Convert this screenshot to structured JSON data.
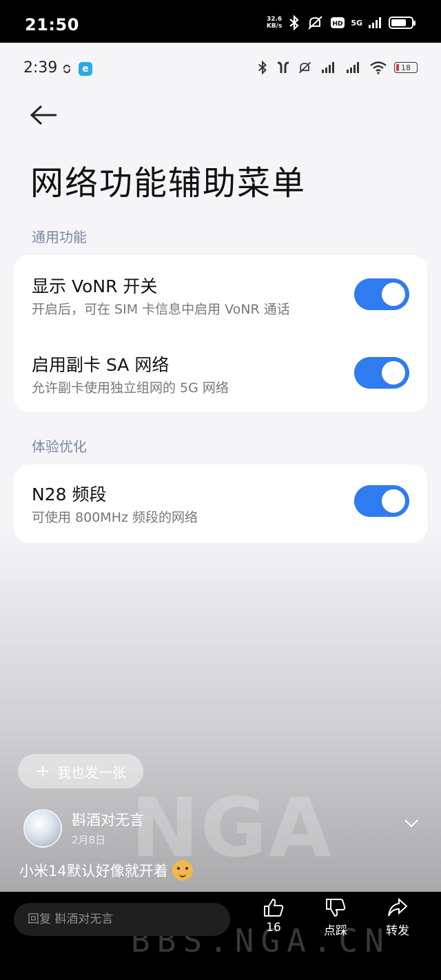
{
  "outer_status": {
    "time": "21:50",
    "speed_value": "32.6",
    "speed_unit": "KB/s",
    "network": "5G"
  },
  "inner_status": {
    "time": "2:39",
    "battery": "18"
  },
  "page": {
    "title": "网络功能辅助菜单"
  },
  "sections": [
    {
      "label": "通用功能",
      "items": [
        {
          "title": "显示 VoNR 开关",
          "subtitle": "开启后，可在 SIM 卡信息中启用 VoNR 通话",
          "enabled": true
        },
        {
          "title": "启用副卡 SA 网络",
          "subtitle": "允许副卡使用独立组网的 5G 网络",
          "enabled": true
        }
      ]
    },
    {
      "label": "体验优化",
      "items": [
        {
          "title": "N28 频段",
          "subtitle": "可使用 800MHz 频段的网络",
          "enabled": true
        }
      ]
    }
  ],
  "post": {
    "button_label": "我也发一张",
    "username": "斟酒对无言",
    "date": "2月8日",
    "comment": "小米14默认好像就开着"
  },
  "watermark": {
    "logo": "NGA",
    "url": "BBS.NGA.CN"
  },
  "bottom": {
    "reply_placeholder": "回复 斟酒对无言",
    "like_count": "16",
    "dislike_label": "点踩",
    "share_label": "转发"
  },
  "colors": {
    "toggle_on": "#2f7bf0",
    "section_label": "#7a86a6"
  },
  "icons": [
    "bluetooth-icon",
    "mute-icon",
    "hd-icon",
    "signal-icon",
    "battery-icon",
    "back-arrow-icon",
    "plus-icon",
    "chevron-down-icon",
    "thumb-up-icon",
    "thumb-down-icon",
    "share-icon"
  ]
}
